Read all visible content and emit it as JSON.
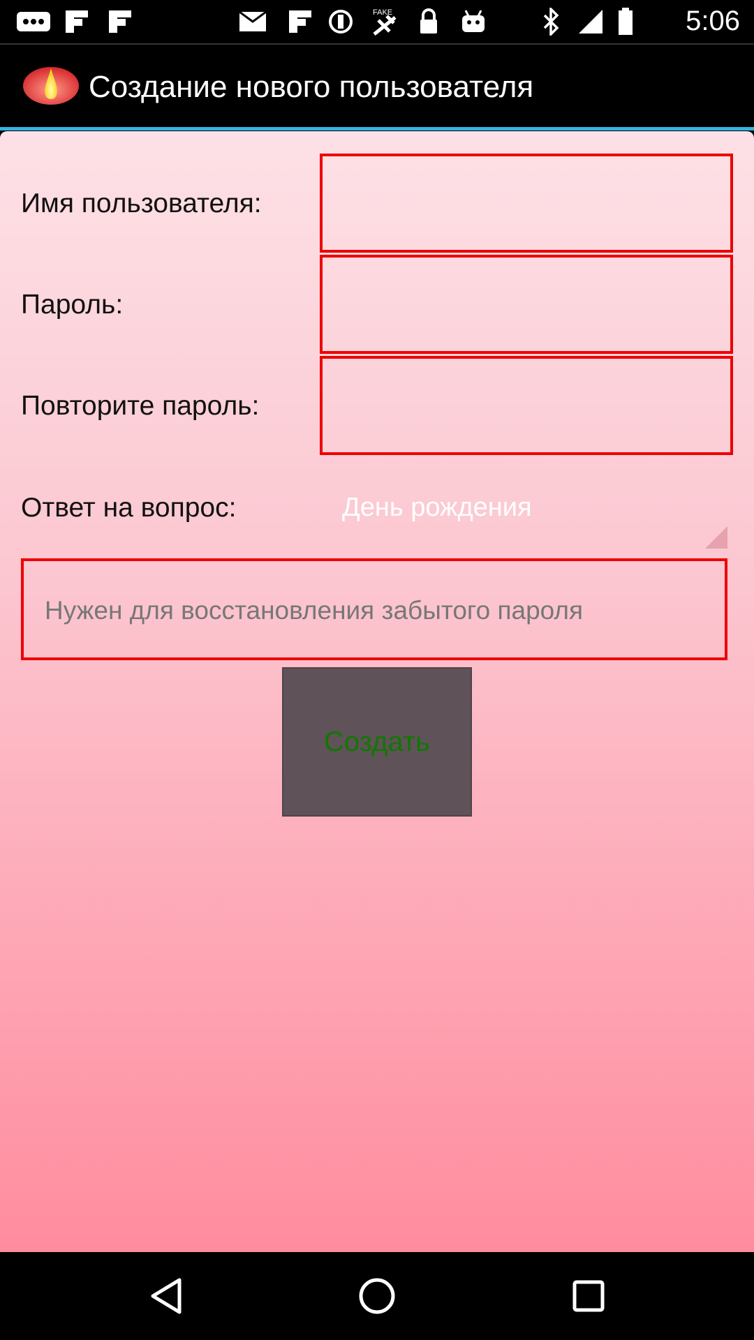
{
  "status_bar": {
    "time": "5:06",
    "icons": [
      "more-icon",
      "flipboard-icon",
      "flipboard-icon",
      "mail-icon",
      "flipboard-icon",
      "sync-icon",
      "satellite-icon",
      "lock-icon",
      "android-icon",
      "bluetooth-icon",
      "signal-icon",
      "battery-icon"
    ]
  },
  "action_bar": {
    "title": "Создание нового пользователя",
    "logo_icon": "flame-logo-icon"
  },
  "form": {
    "username_label": "Имя пользователя:",
    "username_value": "",
    "password_label": "Пароль:",
    "password_value": "",
    "repeat_password_label": "Повторите пароль:",
    "repeat_password_value": "",
    "question_label": "Ответ на вопрос:",
    "question_selected": "День рождения",
    "answer_placeholder": "Нужен для восстановления забытого пароля",
    "create_button": "Создать"
  },
  "colors": {
    "field_border": "#ee0000",
    "accent": "#33b5e5",
    "button_bg": "#605259",
    "button_text": "#117700"
  },
  "nav_bar": {
    "back_icon": "back-icon",
    "home_icon": "home-icon",
    "recents_icon": "recents-icon"
  }
}
